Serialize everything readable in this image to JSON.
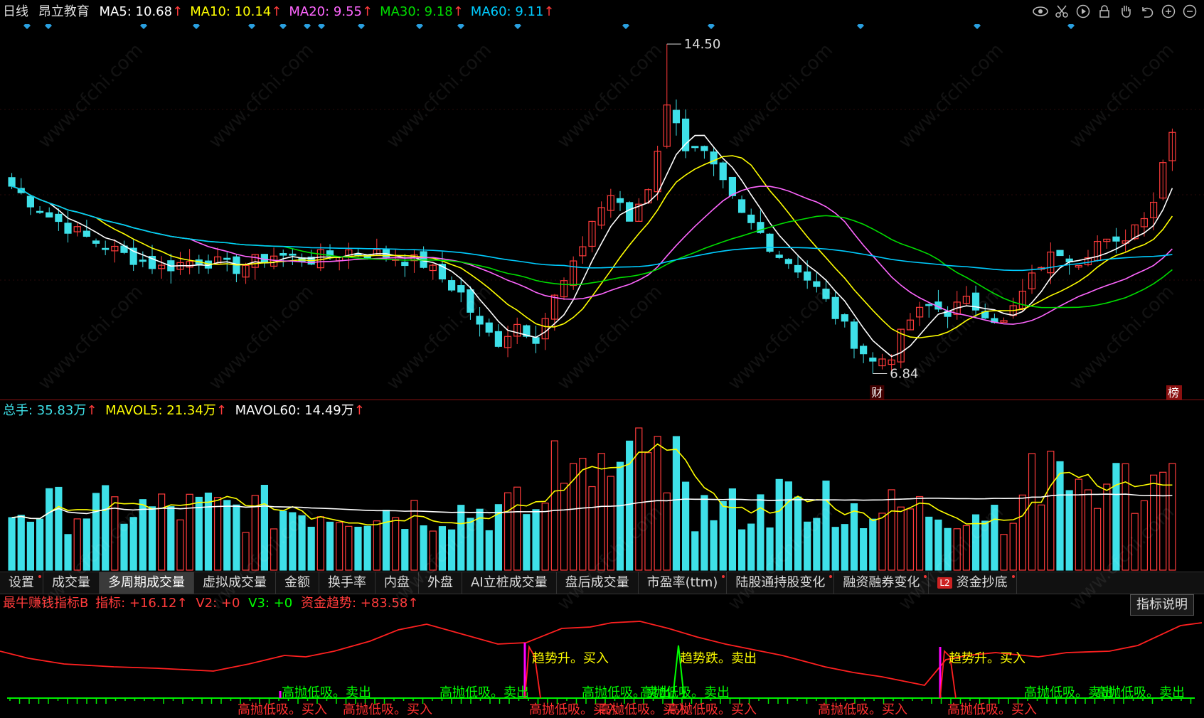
{
  "header": {
    "period": "日线",
    "stock_name": "昂立教育",
    "ma": [
      {
        "label": "MA5: 10.68",
        "color": "#ffffff"
      },
      {
        "label": "MA10: 10.14",
        "color": "#ffff00"
      },
      {
        "label": "MA20: 9.55",
        "color": "#ff66ff"
      },
      {
        "label": "MA30: 9.18",
        "color": "#00dd00"
      },
      {
        "label": "MA60: 9.11",
        "color": "#00ccff"
      }
    ],
    "arrow": "↑"
  },
  "toolbar_icons": [
    "eye-icon",
    "scissors-icon",
    "play-icon",
    "lock-icon",
    "hand-icon",
    "undo-icon",
    "zoom-in-icon",
    "zoom-out-icon"
  ],
  "price_labels": {
    "high": "14.50",
    "low": "6.84"
  },
  "badges": {
    "cai": "财",
    "bang": "榜"
  },
  "volume_header": {
    "total": "总手: 35.83万",
    "mavol5": "MAVOL5: 21.34万",
    "mavol60": "MAVOL60: 14.49万",
    "arrow": "↑"
  },
  "tabs": [
    {
      "label": "设置",
      "dot": true
    },
    {
      "label": "成交量",
      "dot": false
    },
    {
      "label": "多周期成交量",
      "dot": false,
      "active": true
    },
    {
      "label": "虚拟成交量",
      "dot": false
    },
    {
      "label": "金额",
      "dot": false
    },
    {
      "label": "换手率",
      "dot": false
    },
    {
      "label": "内盘",
      "dot": false
    },
    {
      "label": "外盘",
      "dot": false
    },
    {
      "label": "AI立桩成交量",
      "dot": false
    },
    {
      "label": "盘后成交量",
      "dot": false
    },
    {
      "label": "市盈率(ttm)",
      "dot": true
    },
    {
      "label": "陆股通持股变化",
      "dot": true
    },
    {
      "label": "融资融券变化",
      "dot": true
    },
    {
      "label": "资金抄底",
      "dot": true,
      "l2": true
    }
  ],
  "l2_label": "L2",
  "indicator_header": {
    "name": "最牛赚钱指标B",
    "ind": "指标: +16.12",
    "v2": "V2: +0",
    "v3": "V3: +0",
    "trend": "资金趋势: +83.58",
    "arrow": "↑"
  },
  "indicator_button": "指标说明",
  "signals": {
    "upper": [
      {
        "text": "趋势升。买入",
        "color": "#ffff00"
      },
      {
        "text": "趋势跌。卖出",
        "color": "#ffff00"
      },
      {
        "text": "趋势升。买入",
        "color": "#ffff00"
      }
    ],
    "mid": [
      {
        "text": "高抛低吸。卖出",
        "color": "#00ff00"
      },
      {
        "text": "高抛低吸。卖出",
        "color": "#00ff00"
      },
      {
        "text": "高抛低吸。卖出",
        "color": "#00ff00"
      },
      {
        "text": "高抛低吸。卖出",
        "color": "#00ff00"
      },
      {
        "text": "高抛低吸。卖出",
        "color": "#00ff00"
      },
      {
        "text": "高抛低吸。卖出",
        "color": "#00ff00"
      }
    ],
    "low": [
      {
        "text": "高抛低吸。买入",
        "color": "#ff3030"
      },
      {
        "text": "高抛低吸。买入",
        "color": "#ff3030"
      },
      {
        "text": "高抛低吸。买入",
        "color": "#ff3030"
      },
      {
        "text": "高抛低吸。买入",
        "color": "#ff3030"
      },
      {
        "text": "高抛低吸。买入",
        "color": "#ff3030"
      },
      {
        "text": "高抛低吸。买入",
        "color": "#ff3030"
      },
      {
        "text": "高抛低吸。买入",
        "color": "#ff3030"
      }
    ]
  },
  "watermark": "www.cfchi.com",
  "colors": {
    "up": "#ff3b3b",
    "down": "#3ee0e8",
    "ma5": "#ffffff",
    "ma10": "#ffff00",
    "ma20": "#ff66ff",
    "ma30": "#00dd00",
    "ma60": "#00ccff",
    "border": "#8a1010",
    "diamond": "#2aa0e0"
  }
}
